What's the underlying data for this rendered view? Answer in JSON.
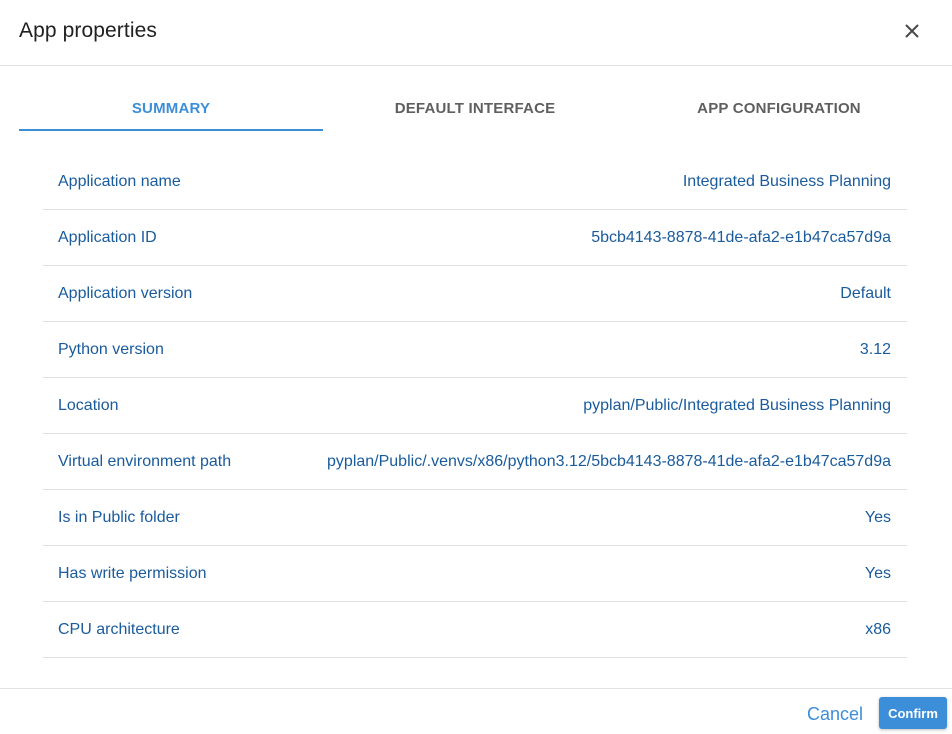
{
  "dialog": {
    "title": "App properties",
    "close_icon": "close-icon"
  },
  "tabs": [
    {
      "label": "SUMMARY",
      "active": true
    },
    {
      "label": "DEFAULT INTERFACE",
      "active": false
    },
    {
      "label": "APP CONFIGURATION",
      "active": false
    }
  ],
  "properties": [
    {
      "label": "Application name",
      "value": "Integrated Business Planning"
    },
    {
      "label": "Application ID",
      "value": "5bcb4143-8878-41de-afa2-e1b47ca57d9a"
    },
    {
      "label": "Application version",
      "value": "Default"
    },
    {
      "label": "Python version",
      "value": "3.12"
    },
    {
      "label": "Location",
      "value": "pyplan/Public/Integrated Business Planning"
    },
    {
      "label": "Virtual environment path",
      "value": "pyplan/Public/.venvs/x86/python3.12/5bcb4143-8878-41de-afa2-e1b47ca57d9a"
    },
    {
      "label": "Is in Public folder",
      "value": "Yes"
    },
    {
      "label": "Has write permission",
      "value": "Yes"
    },
    {
      "label": "CPU architecture",
      "value": "x86"
    }
  ],
  "footer": {
    "cancel_label": "Cancel",
    "confirm_label": "Confirm"
  },
  "colors": {
    "accent": "#3d8ed8",
    "text_primary": "#1a5b9c",
    "title": "#212121",
    "tab_inactive": "#5f5f5f",
    "divider": "#e0e0e0"
  }
}
